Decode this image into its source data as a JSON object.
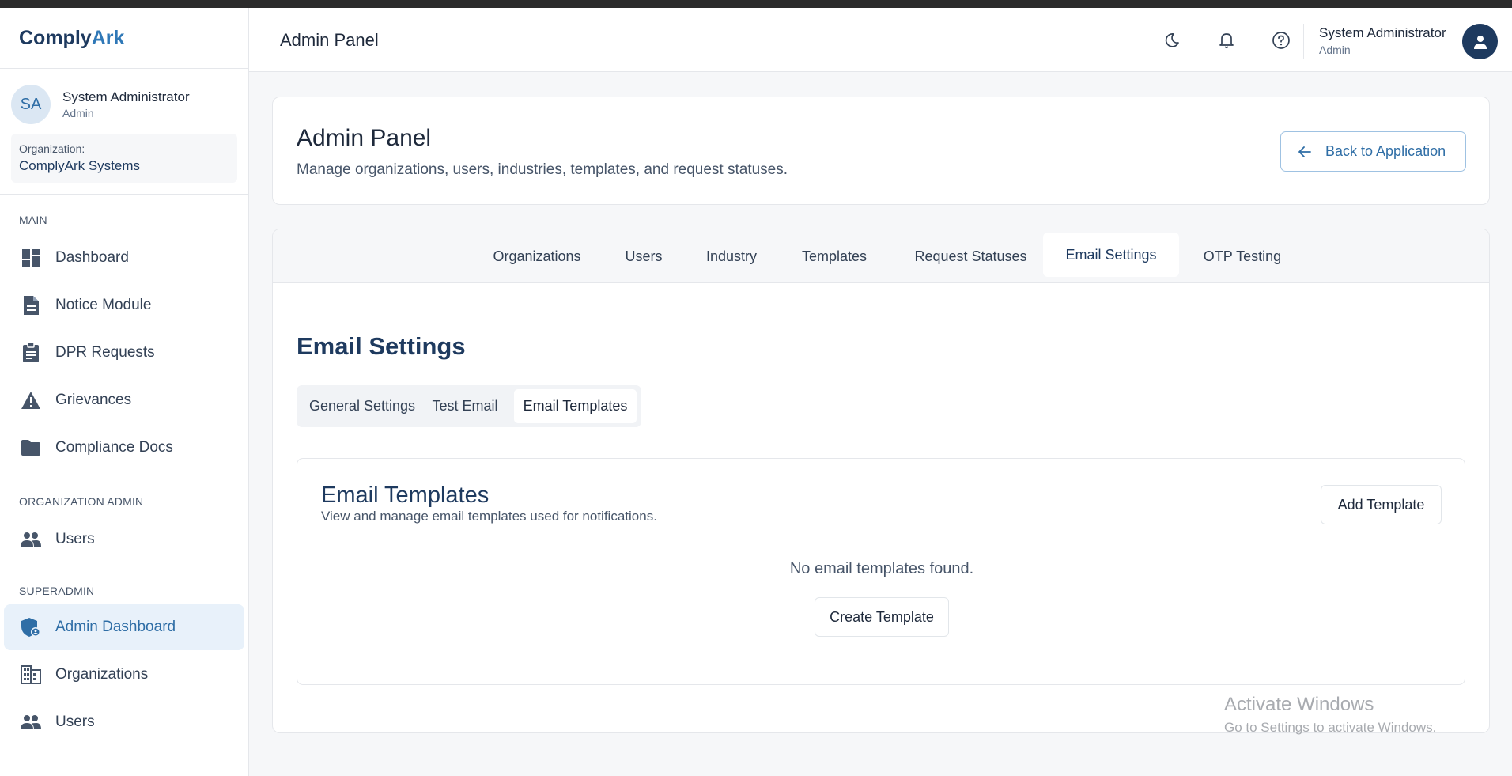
{
  "app": {
    "logo_part1": "Comply",
    "logo_part2": "Ark"
  },
  "sidebar": {
    "user": {
      "initials": "SA",
      "name": "System Administrator",
      "role": "Admin"
    },
    "organization": {
      "label": "Organization:",
      "value": "ComplyArk Systems"
    },
    "sections": [
      {
        "title": "MAIN",
        "items": [
          {
            "label": "Dashboard",
            "icon": "dashboard-icon"
          },
          {
            "label": "Notice Module",
            "icon": "document-icon"
          },
          {
            "label": "DPR Requests",
            "icon": "clipboard-icon"
          },
          {
            "label": "Grievances",
            "icon": "warning-icon"
          },
          {
            "label": "Compliance Docs",
            "icon": "folder-icon"
          }
        ]
      },
      {
        "title": "ORGANIZATION ADMIN",
        "items": [
          {
            "label": "Users",
            "icon": "users-icon"
          }
        ]
      },
      {
        "title": "SUPERADMIN",
        "items": [
          {
            "label": "Admin Dashboard",
            "icon": "admin-shield-icon",
            "active": true
          },
          {
            "label": "Organizations",
            "icon": "building-icon"
          },
          {
            "label": "Users",
            "icon": "users-icon"
          }
        ]
      }
    ]
  },
  "header": {
    "title": "Admin Panel",
    "icons": [
      "moon-icon",
      "bell-icon",
      "help-icon"
    ],
    "user": {
      "name": "System Administrator",
      "role": "Admin"
    }
  },
  "page": {
    "title": "Admin Panel",
    "description": "Manage organizations, users, industries, templates, and request statuses.",
    "back_button": "Back to Application"
  },
  "tabs": [
    {
      "label": "Organizations"
    },
    {
      "label": "Users"
    },
    {
      "label": "Industry"
    },
    {
      "label": "Templates"
    },
    {
      "label": "Request Statuses"
    },
    {
      "label": "Email Settings",
      "active": true
    },
    {
      "label": "OTP Testing"
    }
  ],
  "email_settings": {
    "title": "Email Settings",
    "subtabs": [
      {
        "label": "General Settings"
      },
      {
        "label": "Test Email"
      },
      {
        "label": "Email Templates",
        "active": true
      }
    ],
    "templates": {
      "title": "Email Templates",
      "description": "View and manage email templates used for notifications.",
      "add_button": "Add Template",
      "empty_text": "No email templates found.",
      "create_button": "Create Template"
    }
  },
  "watermark": {
    "line1": "Activate Windows",
    "line2": "Go to Settings to activate Windows."
  },
  "colors": {
    "brand_dark": "#1e3a5f",
    "brand_accent": "#2f78b7",
    "active_bg": "#e8f1fa"
  }
}
